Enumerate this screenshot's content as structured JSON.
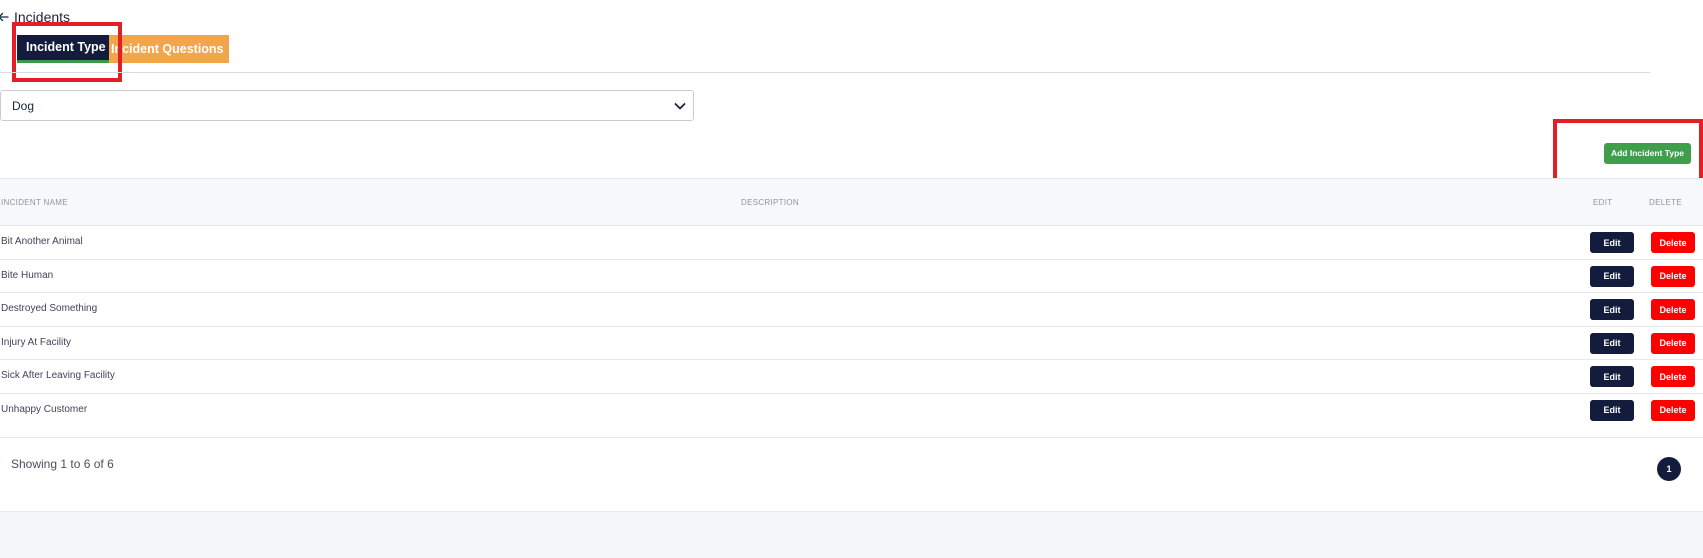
{
  "header": {
    "title": "Incidents",
    "back_icon": "arrow-left-icon"
  },
  "tabs": [
    {
      "label": "Incident Type",
      "active": true
    },
    {
      "label": "Incident Questions",
      "active": false
    }
  ],
  "filter": {
    "selected": "Dog",
    "icon": "chevron-down-icon"
  },
  "toolbar": {
    "add_label": "Add Incident Type"
  },
  "table": {
    "columns": [
      "INCIDENT NAME",
      "DESCRIPTION",
      "EDIT",
      "DELETE"
    ],
    "rows": [
      {
        "name": "Bit Another Animal",
        "description": ""
      },
      {
        "name": "Bite Human",
        "description": ""
      },
      {
        "name": "Destroyed Something",
        "description": ""
      },
      {
        "name": "Injury At Facility",
        "description": ""
      },
      {
        "name": "Sick After Leaving Facility",
        "description": ""
      },
      {
        "name": "Unhappy Customer",
        "description": ""
      }
    ],
    "edit_label": "Edit",
    "delete_label": "Delete"
  },
  "pagination": {
    "summary": "Showing 1 to 6 of 6",
    "current_page": "1"
  },
  "colors": {
    "primary": "#131c3c",
    "success": "#3f9e4a",
    "danger": "#ff0000",
    "warning": "#f2a54a",
    "highlight": "#e31e24"
  }
}
